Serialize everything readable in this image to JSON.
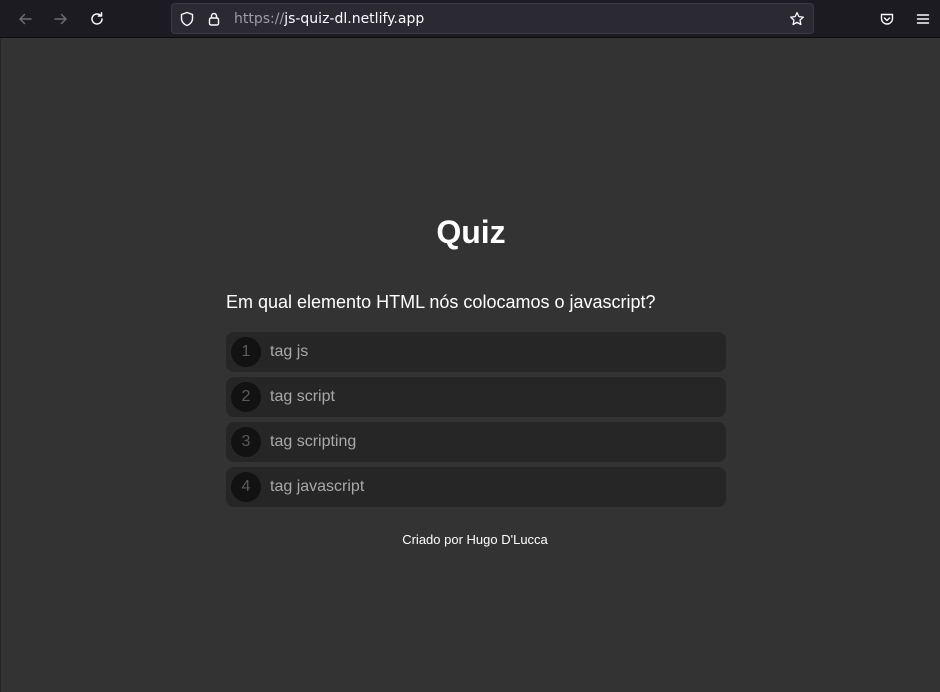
{
  "browser": {
    "url_scheme": "https://",
    "url_host": "js-quiz-dl.netlify.app"
  },
  "quiz": {
    "title": "Quiz",
    "question": "Em qual elemento HTML nós colocamos o javascript?",
    "answers": [
      {
        "number": "1",
        "label": "tag js"
      },
      {
        "number": "2",
        "label": "tag script"
      },
      {
        "number": "3",
        "label": "tag scripting"
      },
      {
        "number": "4",
        "label": "tag javascript"
      }
    ]
  },
  "footer": {
    "text": "Criado por Hugo D'Lucca"
  },
  "colors": {
    "page_background": "#333333",
    "answer_background": "#262626",
    "toolbar_background": "#1c1b22"
  }
}
